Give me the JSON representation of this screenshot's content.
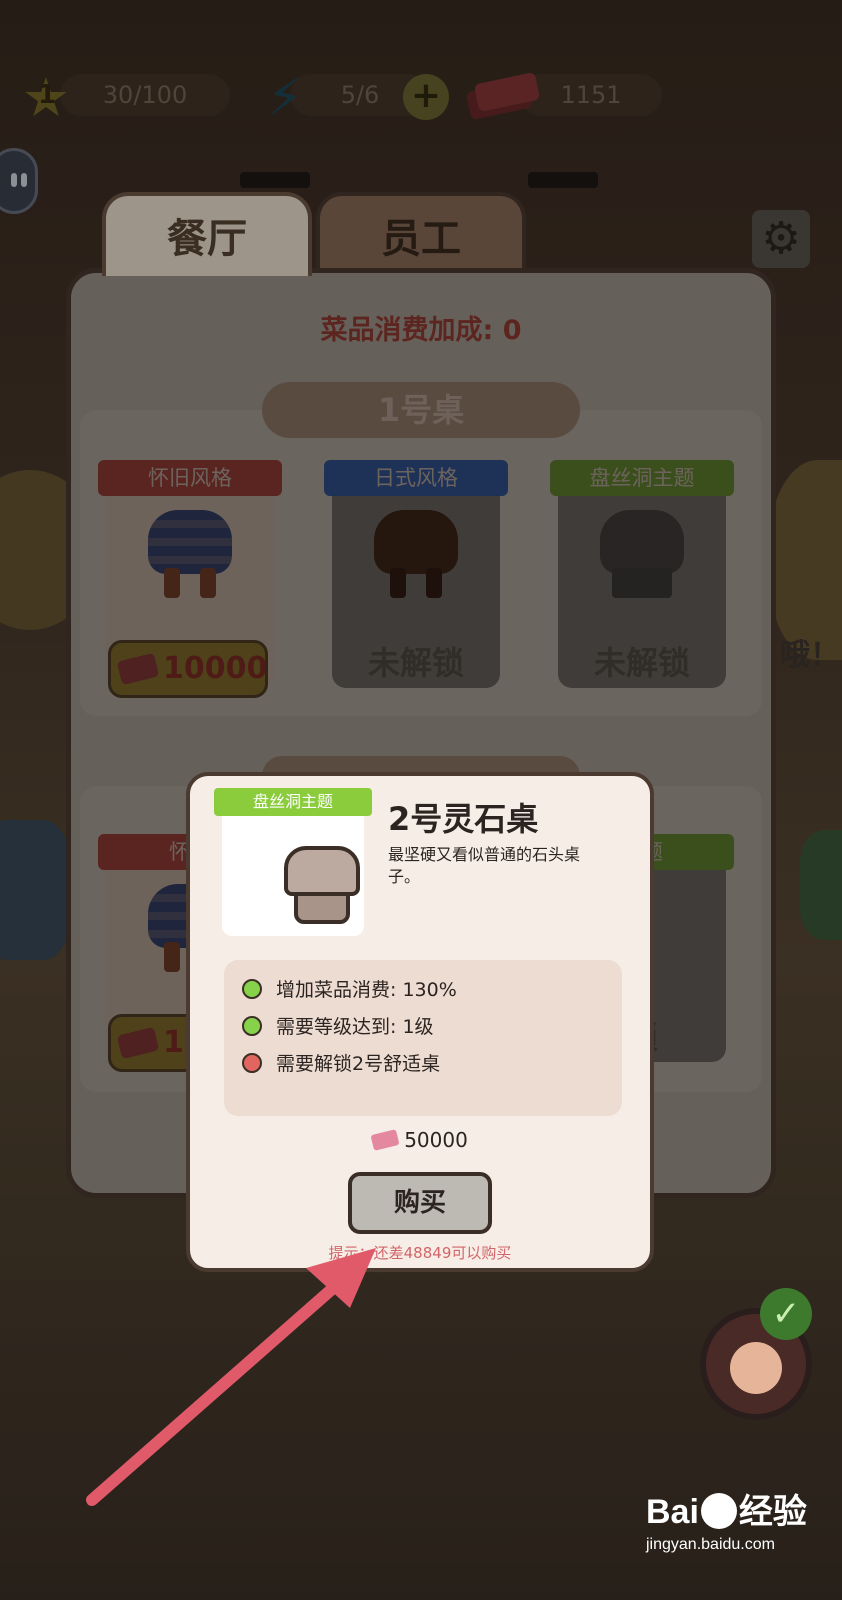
{
  "hud": {
    "level": "1",
    "exp": "30/100",
    "energy": "5/6",
    "money": "1151"
  },
  "tabs": [
    {
      "label": "餐厅",
      "active": true
    },
    {
      "label": "员工",
      "active": false
    }
  ],
  "panel": {
    "bonus": "菜品消费加成: 0",
    "table1": {
      "label": "1号桌",
      "items": [
        {
          "name": "怀旧风格",
          "ribbon_color": "#8a3a34",
          "price": "10000",
          "locked": false
        },
        {
          "name": "日式风格",
          "ribbon_color": "#2e4e86",
          "status": "未解锁",
          "locked": true
        },
        {
          "name": "盘丝洞主题",
          "ribbon_color": "#5a7a2a",
          "status": "未解锁",
          "locked": true
        }
      ]
    },
    "table2": {
      "items": [
        {
          "name": "怀旧",
          "price": "15"
        },
        {
          "name": "主题"
        },
        {
          "status": "锁"
        }
      ]
    }
  },
  "modal": {
    "ribbon": "盘丝洞主题",
    "title": "2号灵石桌",
    "description": "最坚硬又看似普通的石头桌子。",
    "requirements": [
      {
        "text": "增加菜品消费: 130%",
        "met": true
      },
      {
        "text": "需要等级达到:  1级",
        "met": true
      },
      {
        "text": "需要解锁2号舒适桌",
        "met": false
      }
    ],
    "price": "50000",
    "buy_label": "购买",
    "tip": "提示：还差48849可以购买"
  },
  "side_text": "哦！",
  "watermark": {
    "logo_left": "Bai",
    "logo_right": "经验",
    "url": "jingyan.baidu.com"
  },
  "colors": {
    "accent_red": "#e05a6a",
    "ok_dot": "#86d24a",
    "fail_dot": "#e26660",
    "modal_ribbon": "#8acc3c"
  }
}
